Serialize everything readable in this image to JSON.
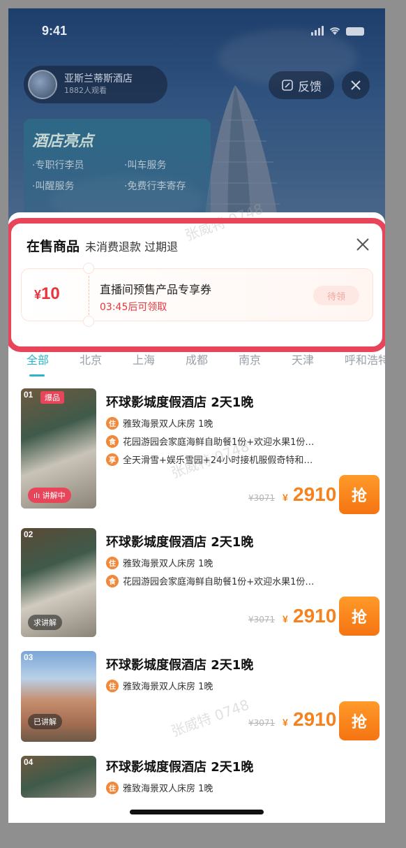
{
  "status_bar": {
    "time": "9:41"
  },
  "host": {
    "name": "亚斯兰蒂斯酒店",
    "viewers": "1882人观看"
  },
  "header_actions": {
    "feedback_label": "反馈"
  },
  "highlights": {
    "title": "酒店亮点",
    "items": [
      "·专职行李员",
      "·叫车服务",
      "·叫醒服务",
      "·免费行李寄存"
    ]
  },
  "sheet": {
    "title": "在售商品",
    "subtitle": "未消费退款 过期退"
  },
  "coupon": {
    "currency": "¥",
    "amount": "10",
    "name": "直播间预售产品专享券",
    "countdown": "03:45后可领取",
    "button": "待领"
  },
  "tabs": [
    "全部",
    "北京",
    "上海",
    "成都",
    "南京",
    "天津",
    "呼和浩特"
  ],
  "active_tab": "全部",
  "products": [
    {
      "rank": "01",
      "hot": "爆品",
      "badge": "讲解中",
      "title": "环球影城度假酒店 2天1晚",
      "features": [
        {
          "icon": "住",
          "text": "雅致海景双人床房 1晚"
        },
        {
          "icon": "食",
          "text": "花园游园会家庭海鲜自助餐1份+欢迎水果1份…"
        },
        {
          "icon": "享",
          "text": "全天滑雪+娱乐雪园+24小时接机服假奇特和…"
        }
      ],
      "original_price": "¥3071",
      "currency": "¥",
      "price": "2910",
      "buy_label": "抢"
    },
    {
      "rank": "02",
      "badge": "求讲解",
      "title": "环球影城度假酒店 2天1晚",
      "features": [
        {
          "icon": "住",
          "text": "雅致海景双人床房 1晚"
        },
        {
          "icon": "食",
          "text": "花园游园会家庭海鲜自助餐1份+欢迎水果1份…"
        }
      ],
      "original_price": "¥3071",
      "currency": "¥",
      "price": "2910",
      "buy_label": "抢"
    },
    {
      "rank": "03",
      "badge": "已讲解",
      "title": "环球影城度假酒店 2天1晚",
      "features": [
        {
          "icon": "住",
          "text": "雅致海景双人床房 1晚"
        }
      ],
      "original_price": "¥3071",
      "currency": "¥",
      "price": "2910",
      "buy_label": "抢"
    },
    {
      "rank": "04",
      "title": "环球影城度假酒店 2天1晚",
      "features": [
        {
          "icon": "住",
          "text": "雅致海景双人床房 1晚"
        }
      ]
    }
  ],
  "watermark": "张威特 0748",
  "colors": {
    "accent": "#2bb5c9",
    "price": "#f5821f",
    "highlight_border": "#e8455a",
    "coupon_red": "#e8343a"
  }
}
